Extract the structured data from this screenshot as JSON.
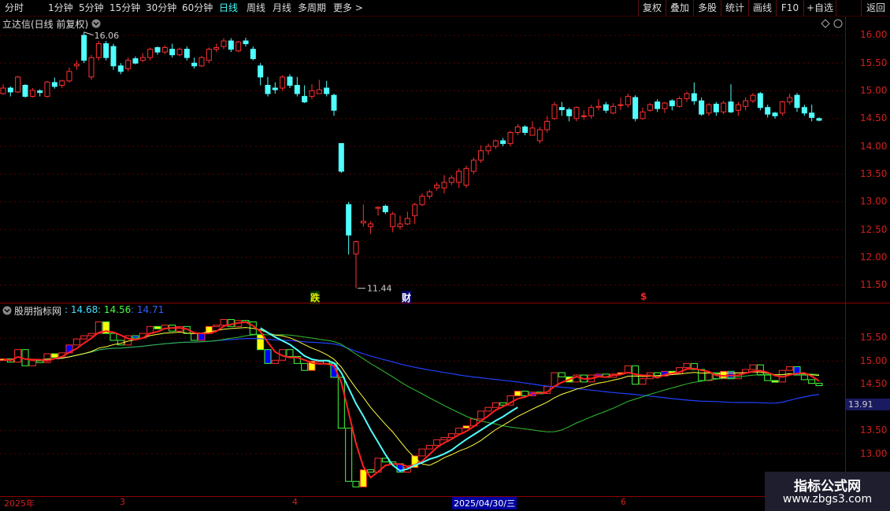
{
  "toolbar": {
    "periods": [
      "分时",
      "1分钟",
      "5分钟",
      "15分钟",
      "30分钟",
      "60分钟",
      "日线",
      "周线",
      "月线",
      "多周期",
      "更多 >"
    ],
    "active_period": "日线",
    "right_buttons": [
      "复权",
      "叠加",
      "多股",
      "统计",
      "画线",
      "F10",
      "+自选",
      "返回"
    ]
  },
  "main_chart": {
    "title": "立达信(日线 前复权)",
    "high_label": "16.06",
    "low_label": "11.44",
    "price_axis": [
      "16.00",
      "15.50",
      "15.00",
      "14.50",
      "14.00",
      "13.50",
      "13.00",
      "12.50",
      "12.00",
      "11.50"
    ],
    "markers": [
      {
        "text": "跌",
        "color": "#e8e800"
      },
      {
        "text": "财",
        "color": "#ffffff"
      },
      {
        "text": "$",
        "color": "#ff2020"
      }
    ]
  },
  "indicator_panel": {
    "name": "股朋指标网",
    "values": [
      {
        "text": ": 14.68",
        "color": "#40e0ff"
      },
      {
        "text": ": 14.56",
        "color": "#40ff40"
      },
      {
        "text": ": 14.71",
        "color": "#3060ff"
      }
    ],
    "price_axis": [
      "15.50",
      "15.00",
      "14.50",
      "13.50",
      "13.00"
    ],
    "current_value": "13.91"
  },
  "date_axis": {
    "labels": [
      "2025年",
      "3",
      "4",
      "6"
    ],
    "selected_date": "2025/04/30/三"
  },
  "watermark": {
    "line1": "指标公式网",
    "line2": "www.zbgs3.com"
  },
  "colors": {
    "up": "#ff3030",
    "down": "#50ffff",
    "grid": "#5a0000",
    "axis": "#d02020",
    "accent": "#0000a0"
  },
  "chart_data": {
    "type": "candlestick",
    "title": "立达信(日线 前复权)",
    "ylim": [
      11.3,
      16.3
    ],
    "annotations": [
      {
        "text": "16.06",
        "value": 16.06
      },
      {
        "text": "11.44",
        "value": 11.44
      }
    ],
    "candles": [
      [
        14.95,
        15.05,
        14.93,
        15.12
      ],
      [
        15.05,
        14.98,
        14.9,
        15.08
      ],
      [
        14.98,
        15.25,
        14.96,
        15.27
      ],
      [
        15.1,
        14.9,
        14.88,
        15.12
      ],
      [
        14.9,
        15.01,
        14.88,
        15.05
      ],
      [
        15.0,
        14.97,
        14.9,
        15.03
      ],
      [
        14.9,
        15.16,
        14.88,
        15.18
      ],
      [
        15.15,
        15.08,
        15.04,
        15.24
      ],
      [
        15.1,
        15.18,
        15.05,
        15.2
      ],
      [
        15.18,
        15.35,
        15.15,
        15.42
      ],
      [
        15.45,
        15.48,
        15.38,
        15.55
      ],
      [
        16.0,
        15.55,
        15.5,
        16.06
      ],
      [
        15.25,
        15.6,
        15.2,
        15.65
      ],
      [
        15.6,
        15.85,
        15.55,
        15.9
      ],
      [
        15.85,
        15.6,
        15.55,
        15.9
      ],
      [
        15.8,
        15.45,
        15.38,
        15.85
      ],
      [
        15.45,
        15.35,
        15.3,
        15.5
      ],
      [
        15.4,
        15.55,
        15.35,
        15.6
      ],
      [
        15.58,
        15.5,
        15.48,
        15.62
      ],
      [
        15.55,
        15.6,
        15.52,
        15.68
      ],
      [
        15.6,
        15.75,
        15.55,
        15.78
      ],
      [
        15.78,
        15.7,
        15.65,
        15.8
      ],
      [
        15.7,
        15.78,
        15.66,
        15.82
      ],
      [
        15.75,
        15.65,
        15.6,
        15.85
      ],
      [
        15.65,
        15.75,
        15.62,
        15.78
      ],
      [
        15.75,
        15.6,
        15.55,
        15.8
      ],
      [
        15.5,
        15.45,
        15.4,
        15.6
      ],
      [
        15.45,
        15.6,
        15.43,
        15.63
      ],
      [
        15.55,
        15.75,
        15.5,
        15.78
      ],
      [
        15.75,
        15.78,
        15.7,
        15.85
      ],
      [
        15.8,
        15.9,
        15.75,
        15.95
      ],
      [
        15.9,
        15.75,
        15.7,
        15.95
      ],
      [
        15.72,
        15.88,
        15.7,
        15.9
      ],
      [
        15.9,
        15.85,
        15.8,
        15.96
      ],
      [
        15.75,
        15.58,
        15.55,
        15.8
      ],
      [
        15.45,
        15.25,
        15.1,
        15.5
      ],
      [
        15.1,
        14.95,
        14.9,
        15.25
      ],
      [
        15.05,
        15.02,
        14.95,
        15.15
      ],
      [
        15.05,
        15.25,
        15.0,
        15.28
      ],
      [
        15.25,
        15.1,
        15.05,
        15.3
      ],
      [
        15.1,
        14.95,
        14.9,
        15.25
      ],
      [
        14.9,
        14.8,
        14.78,
        15.1
      ],
      [
        14.9,
        15.0,
        14.85,
        15.12
      ],
      [
        14.95,
        15.02,
        14.95,
        15.2
      ],
      [
        15.05,
        14.95,
        14.9,
        15.18
      ],
      [
        14.92,
        14.65,
        14.55,
        14.95
      ],
      [
        14.05,
        13.55,
        13.52,
        14.05
      ],
      [
        12.95,
        12.4,
        12.05,
        13.0
      ],
      [
        12.06,
        12.28,
        11.44,
        12.3
      ],
      [
        12.62,
        12.65,
        12.55,
        12.95
      ],
      [
        12.55,
        12.6,
        12.42,
        12.65
      ],
      [
        12.88,
        12.9,
        12.75,
        12.92
      ],
      [
        12.92,
        12.82,
        12.78,
        12.95
      ],
      [
        12.55,
        12.78,
        12.45,
        12.82
      ],
      [
        12.55,
        12.6,
        12.5,
        12.75
      ],
      [
        12.6,
        12.7,
        12.58,
        12.82
      ],
      [
        12.75,
        12.95,
        12.6,
        12.98
      ],
      [
        12.95,
        13.1,
        12.92,
        13.15
      ],
      [
        13.1,
        13.18,
        13.05,
        13.22
      ],
      [
        13.25,
        13.3,
        13.2,
        13.35
      ],
      [
        13.25,
        13.35,
        13.15,
        13.48
      ],
      [
        13.35,
        13.43,
        13.3,
        13.48
      ],
      [
        13.35,
        13.55,
        13.25,
        13.6
      ],
      [
        13.3,
        13.6,
        13.25,
        13.65
      ],
      [
        13.55,
        13.75,
        13.5,
        13.8
      ],
      [
        13.75,
        13.92,
        13.7,
        14.02
      ],
      [
        13.92,
        14.0,
        13.85,
        14.05
      ],
      [
        14.0,
        14.1,
        13.95,
        14.12
      ],
      [
        14.1,
        14.05,
        14.0,
        14.15
      ],
      [
        14.05,
        14.25,
        14.0,
        14.28
      ],
      [
        14.25,
        14.35,
        14.2,
        14.4
      ],
      [
        14.35,
        14.25,
        14.2,
        14.38
      ],
      [
        14.2,
        14.33,
        14.2,
        14.45
      ],
      [
        14.1,
        14.3,
        14.05,
        14.35
      ],
      [
        14.3,
        14.45,
        14.25,
        14.55
      ],
      [
        14.5,
        14.75,
        14.48,
        14.8
      ],
      [
        14.7,
        14.66,
        14.55,
        14.8
      ],
      [
        14.66,
        14.55,
        14.45,
        14.7
      ],
      [
        14.5,
        14.7,
        14.45,
        14.72
      ],
      [
        14.55,
        14.55,
        14.48,
        14.65
      ],
      [
        14.55,
        14.7,
        14.5,
        14.75
      ],
      [
        14.7,
        14.72,
        14.65,
        14.85
      ],
      [
        14.75,
        14.65,
        14.6,
        14.8
      ],
      [
        14.6,
        14.72,
        14.58,
        14.78
      ],
      [
        14.75,
        14.75,
        14.65,
        14.88
      ],
      [
        14.75,
        14.9,
        14.7,
        14.95
      ],
      [
        14.88,
        14.5,
        14.45,
        14.92
      ],
      [
        14.5,
        14.62,
        14.48,
        14.7
      ],
      [
        14.65,
        14.75,
        14.62,
        14.78
      ],
      [
        14.8,
        14.68,
        14.62,
        14.85
      ],
      [
        14.68,
        14.78,
        14.6,
        14.8
      ],
      [
        14.82,
        14.73,
        14.65,
        14.85
      ],
      [
        14.72,
        14.86,
        14.7,
        14.9
      ],
      [
        14.86,
        14.95,
        14.8,
        14.98
      ],
      [
        14.95,
        14.82,
        14.75,
        15.15
      ],
      [
        14.82,
        14.58,
        14.55,
        14.88
      ],
      [
        14.6,
        14.75,
        14.55,
        14.78
      ],
      [
        14.76,
        14.62,
        14.55,
        14.8
      ],
      [
        14.62,
        14.78,
        14.58,
        14.82
      ],
      [
        14.8,
        14.62,
        14.6,
        15.12
      ],
      [
        14.65,
        14.75,
        14.55,
        14.8
      ],
      [
        14.72,
        14.82,
        14.65,
        14.88
      ],
      [
        14.82,
        14.92,
        14.78,
        14.96
      ],
      [
        14.95,
        14.7,
        14.65,
        14.98
      ],
      [
        14.7,
        14.58,
        14.52,
        14.75
      ],
      [
        14.6,
        14.55,
        14.5,
        14.62
      ],
      [
        14.6,
        14.8,
        14.55,
        14.82
      ],
      [
        14.8,
        14.88,
        14.75,
        14.95
      ],
      [
        14.92,
        14.7,
        14.62,
        14.96
      ],
      [
        14.7,
        14.6,
        14.55,
        14.75
      ],
      [
        14.6,
        14.52,
        14.45,
        14.75
      ],
      [
        14.5,
        14.47,
        14.45,
        14.52
      ]
    ]
  }
}
